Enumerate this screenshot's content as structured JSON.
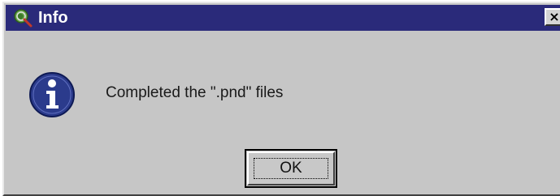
{
  "window": {
    "title": "Info",
    "close_glyph": "×",
    "close_icon": "close-icon",
    "app_icon": "globe-magnifier-icon"
  },
  "body": {
    "icon": "information-icon",
    "message": "Completed the \".pnd\" files"
  },
  "buttons": {
    "ok_label": "OK"
  },
  "colors": {
    "titlebar": "#2a2a7a",
    "dialog_bg": "#c6c6c6",
    "info_icon_fill": "#2b3b8c"
  }
}
